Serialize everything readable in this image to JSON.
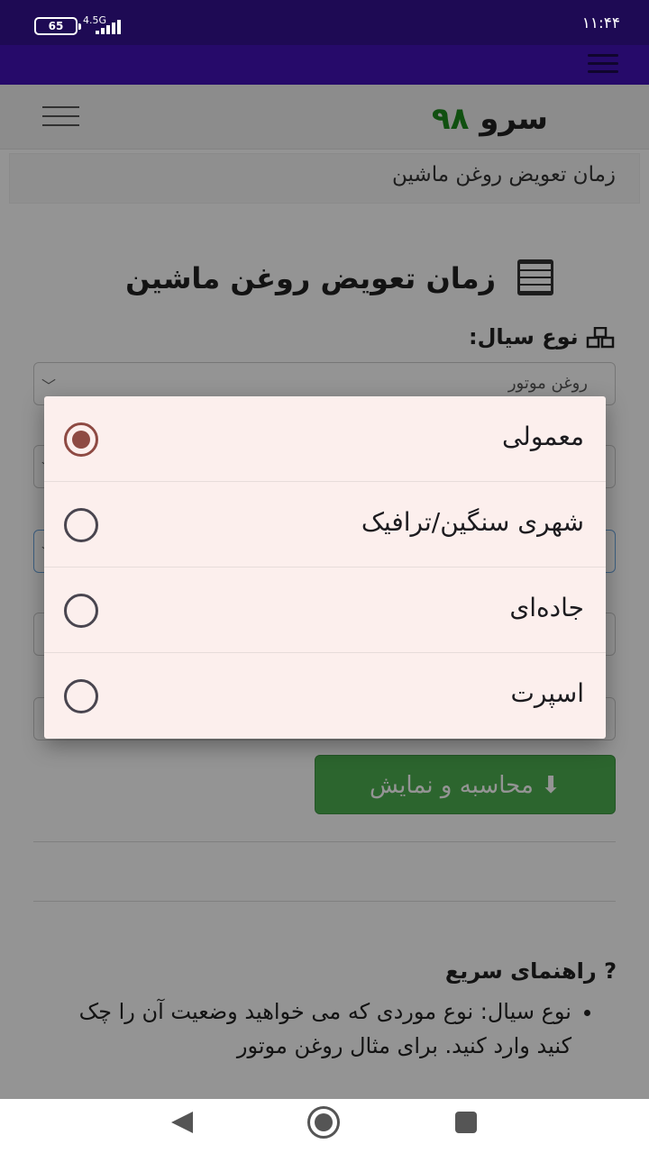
{
  "status_bar": {
    "battery": "65",
    "network": "4.5G",
    "time": "۱۱:۴۴"
  },
  "app": {
    "logo_text": "سرو",
    "logo_number": "۹۸",
    "breadcrumb": "زمان تعویض روغن ماشین",
    "page_title": "زمان تعویض روغن ماشین",
    "fluid_label": "نوع سیال:",
    "fluid_select_value": "روغن موتور",
    "submit_label": "محاسبه و نمایش",
    "guide_title": "راهنمای سریع",
    "guide_items": [
      "نوع سیال: نوع موردی که می خواهید وضعیت آن را چک کنید وارد کنید. برای مثال روغن موتور"
    ]
  },
  "dialog": {
    "options": [
      {
        "label": "معمولی",
        "selected": true
      },
      {
        "label": "شهری سنگین/ترافیک",
        "selected": false
      },
      {
        "label": "جاده‌ای",
        "selected": false
      },
      {
        "label": "اسپرت",
        "selected": false
      }
    ]
  }
}
